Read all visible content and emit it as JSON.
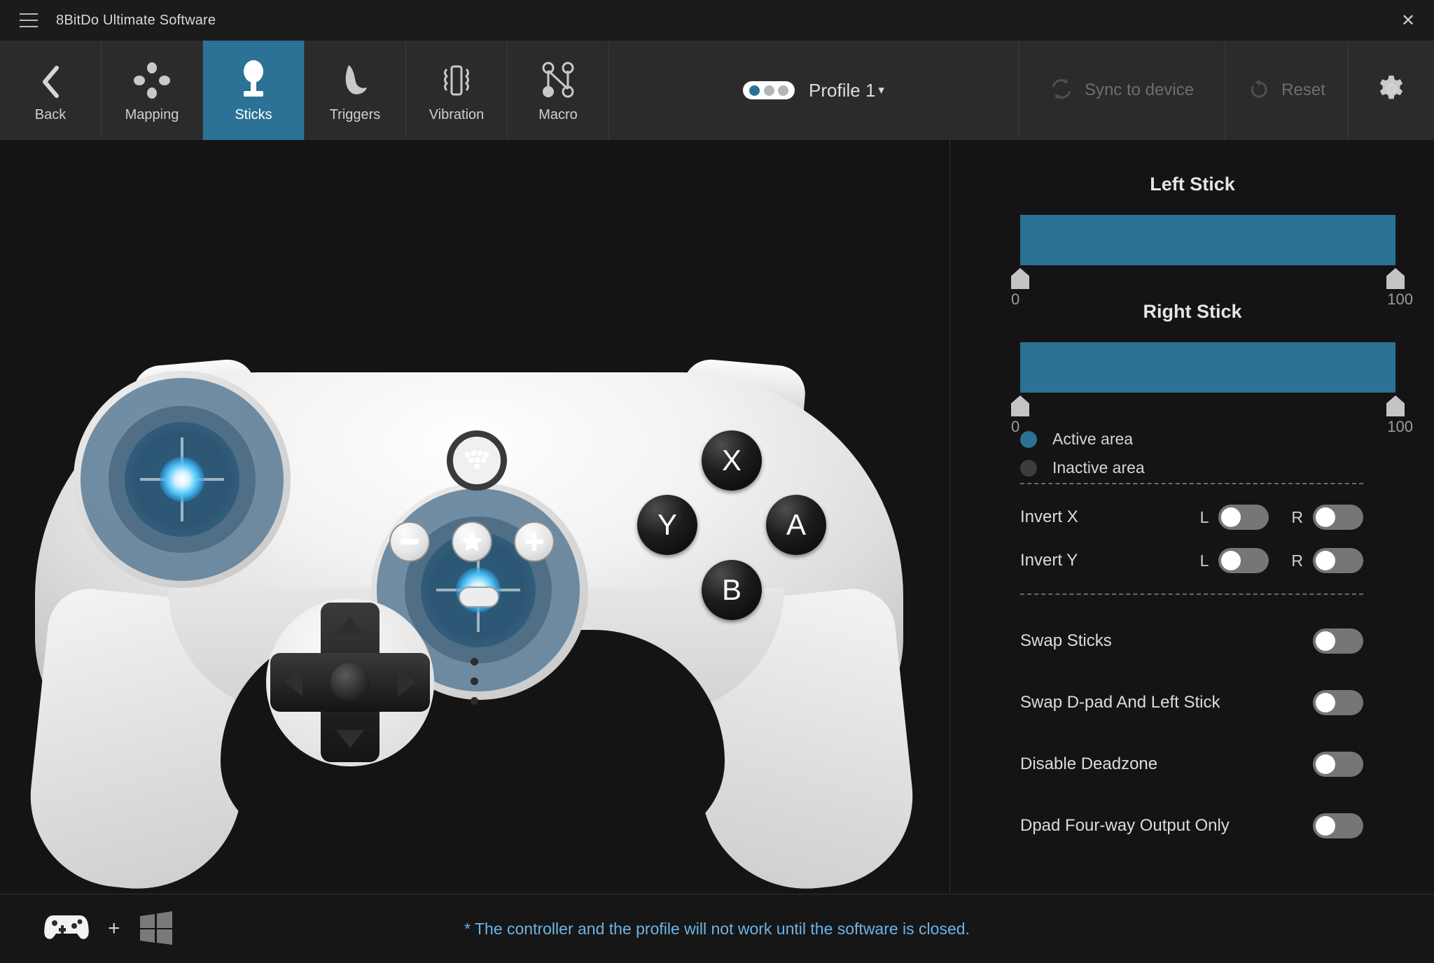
{
  "window": {
    "title": "8BitDo Ultimate Software",
    "menu_icon": "hamburger-icon",
    "close_icon": "close-icon"
  },
  "toolbar": {
    "items": [
      {
        "label": "Back",
        "icon": "chevron-left-icon",
        "active": false
      },
      {
        "label": "Mapping",
        "icon": "dpad-dots-icon",
        "active": false
      },
      {
        "label": "Sticks",
        "icon": "joystick-icon",
        "active": true
      },
      {
        "label": "Triggers",
        "icon": "trigger-icon",
        "active": false
      },
      {
        "label": "Vibration",
        "icon": "vibration-icon",
        "active": false
      },
      {
        "label": "Macro",
        "icon": "macro-node-icon",
        "active": false
      }
    ],
    "profile": {
      "name": "Profile 1",
      "dots": [
        true,
        false,
        false
      ],
      "chevron": "▾"
    },
    "sync": {
      "label": "Sync to device",
      "icon": "sync-icon",
      "disabled": true
    },
    "reset": {
      "label": "Reset",
      "icon": "undo-icon",
      "disabled": true
    },
    "settings": {
      "icon": "gear-icon"
    }
  },
  "controller": {
    "face_buttons": [
      {
        "label": "X"
      },
      {
        "label": "Y"
      },
      {
        "label": "A"
      },
      {
        "label": "B"
      }
    ],
    "center_buttons": [
      {
        "name": "minus-button",
        "glyph": "–"
      },
      {
        "name": "star-button",
        "glyph": "★"
      },
      {
        "name": "plus-button",
        "glyph": "+"
      }
    ],
    "home_button": "home-heart-icon",
    "dpad": "dpad"
  },
  "panel": {
    "left_stick": {
      "title": "Left Stick",
      "min_label": "0",
      "max_label": "100",
      "min_value": 0,
      "max_value": 100
    },
    "right_stick": {
      "title": "Right Stick",
      "min_label": "0",
      "max_label": "100",
      "min_value": 0,
      "max_value": 100
    },
    "legend": [
      {
        "label": "Active area",
        "color": "#2b7296"
      },
      {
        "label": "Inactive area",
        "color": "#3d3d3d"
      }
    ],
    "invert": [
      {
        "label": "Invert X",
        "left_tag": "L",
        "right_tag": "R",
        "left_on": false,
        "right_on": false
      },
      {
        "label": "Invert Y",
        "left_tag": "L",
        "right_tag": "R",
        "left_on": false,
        "right_on": false
      }
    ],
    "options": [
      {
        "label": "Swap Sticks",
        "on": false
      },
      {
        "label": "Swap D-pad And Left Stick",
        "on": false
      },
      {
        "label": "Disable Deadzone",
        "on": false
      },
      {
        "label": "Dpad Four-way Output Only",
        "on": false
      }
    ]
  },
  "statusbar": {
    "controller_icon": "gamepad-icon",
    "plus": "+",
    "platform_icon": "windows-icon",
    "note": "* The controller and the profile will not work until the software is closed."
  },
  "colors": {
    "accent": "#2b7296",
    "glow": "#4ec3f7",
    "note_text": "#6db3e6",
    "toggle_off": "#767676",
    "panel_bg": "#141414"
  }
}
